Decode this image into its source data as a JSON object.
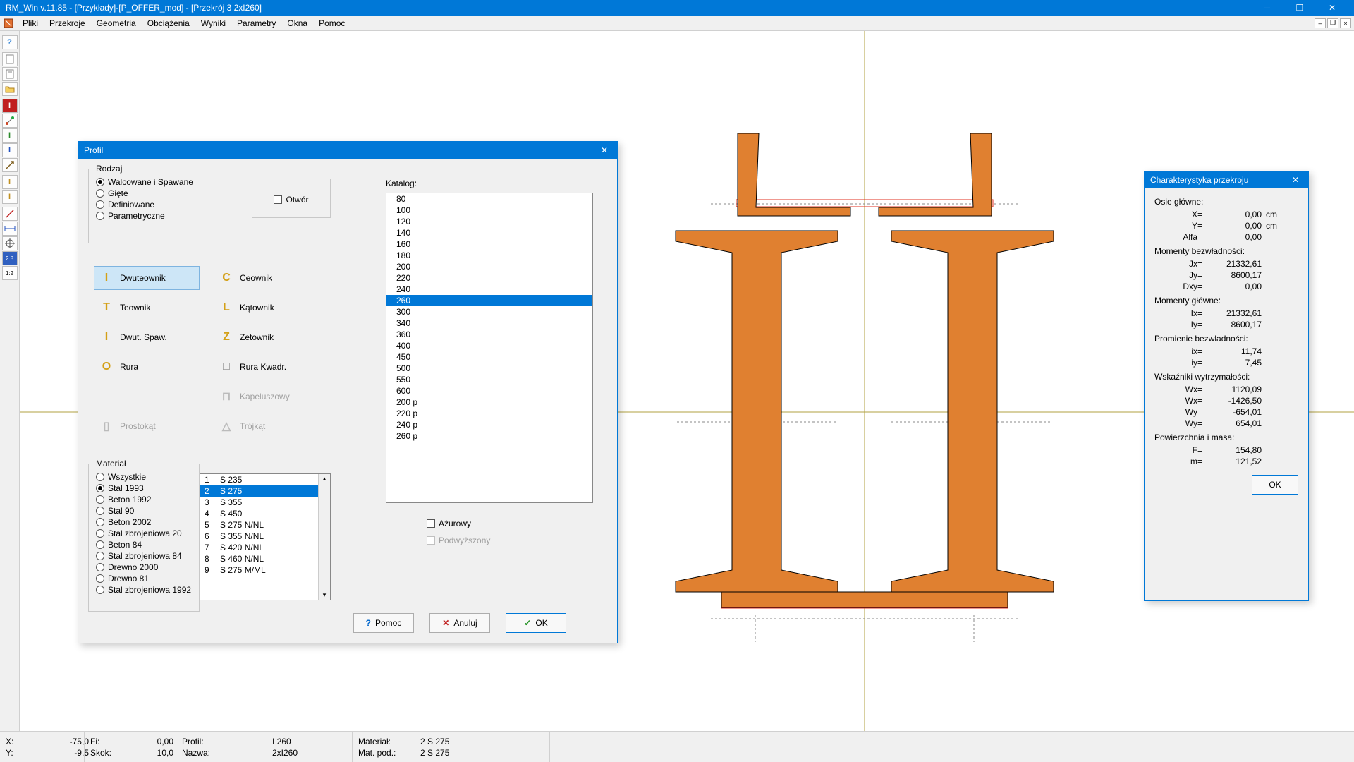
{
  "title": "RM_Win v.11.85 - [Przykłady]-[P_OFFER_mod] - [Przekrój  3  2xI260]",
  "menu": [
    "Pliki",
    "Przekroje",
    "Geometria",
    "Obciążenia",
    "Wyniki",
    "Parametry",
    "Okna",
    "Pomoc"
  ],
  "sidetools": [
    "?",
    "📄",
    "📄",
    "📂",
    "I",
    "⊕",
    "I",
    "I",
    "↗",
    "",
    "I",
    "I",
    "",
    "↗",
    "I",
    "↔",
    "⊕",
    "2.8",
    "1:2"
  ],
  "profile_dialog": {
    "title": "Profil",
    "rodzaj_label": "Rodzaj",
    "rodzaj_options": [
      "Walcowane i Spawane",
      "Gięte",
      "Definiowane",
      "Parametryczne"
    ],
    "otwor_label": "Otwór",
    "shapes": [
      {
        "label": "Dwuteownik",
        "sel": true,
        "icon": "I",
        "color": "#d4a017"
      },
      {
        "label": "Ceownik",
        "icon": "C",
        "color": "#d4a017"
      },
      {
        "label": "Teownik",
        "icon": "T",
        "color": "#d4a017"
      },
      {
        "label": "Kątownik",
        "icon": "L",
        "color": "#d4a017"
      },
      {
        "label": "Dwut. Spaw.",
        "icon": "I",
        "color": "#d4a017"
      },
      {
        "label": "Zetownik",
        "icon": "Z",
        "color": "#d4a017"
      },
      {
        "label": "Rura",
        "icon": "O",
        "color": "#d4a017"
      },
      {
        "label": "Rura Kwadr.",
        "icon": "□",
        "color": "#888"
      },
      {
        "label": "Kapeluszowy",
        "dis": true,
        "icon": "⊓",
        "color": "#bbb"
      },
      {
        "label": "Prostokąt",
        "dis": true,
        "icon": "▯",
        "color": "#bbb"
      },
      {
        "label": "Trójkąt",
        "dis": true,
        "icon": "△",
        "color": "#bbb"
      }
    ],
    "katalog_label": "Katalog:",
    "katalog_items": [
      "80",
      "100",
      "120",
      "140",
      "160",
      "180",
      "200",
      "220",
      "240",
      "260",
      "300",
      "340",
      "360",
      "400",
      "450",
      "500",
      "550",
      "600",
      "200 p",
      "220 p",
      "240 p",
      "260 p"
    ],
    "katalog_selected": "260",
    "azurowy_label": "Ażurowy",
    "podwyzszony_label": "Podwyższony",
    "material_label": "Materiał",
    "material_options": [
      "Wszystkie",
      "Stal 1993",
      "Beton 1992",
      "Stal 90",
      "Beton 2002",
      "Stal zbrojeniowa 20",
      "Beton 84",
      "Stal zbrojeniowa 84",
      "Drewno 2000",
      "Drewno 81",
      "Stal zbrojeniowa 1992"
    ],
    "material_checked": "Stal 1993",
    "material_list": [
      {
        "n": "1",
        "t": "S 235"
      },
      {
        "n": "2",
        "t": "S 275",
        "sel": true
      },
      {
        "n": "3",
        "t": "S 355"
      },
      {
        "n": "4",
        "t": "S 450"
      },
      {
        "n": "5",
        "t": "S 275 N/NL"
      },
      {
        "n": "6",
        "t": "S 355 N/NL"
      },
      {
        "n": "7",
        "t": "S 420 N/NL"
      },
      {
        "n": "8",
        "t": "S 460 N/NL"
      },
      {
        "n": "9",
        "t": "S 275 M/ML"
      }
    ],
    "btn_pomoc": "Pomoc",
    "btn_anuluj": "Anuluj",
    "btn_ok": "OK"
  },
  "char_dialog": {
    "title": "Charakterystyka przekroju",
    "sections": [
      {
        "title": "Osie główne:",
        "rows": [
          {
            "k": "X=",
            "v": "0,00",
            "u": "cm"
          },
          {
            "k": "Y=",
            "v": "0,00",
            "u": "cm"
          },
          {
            "k": "Alfa=",
            "v": "0,00",
            "u": ""
          }
        ]
      },
      {
        "title": "Momenty bezwładności:",
        "rows": [
          {
            "k": "Jx=",
            "v": "21332,61",
            "u": ""
          },
          {
            "k": "Jy=",
            "v": "8600,17",
            "u": ""
          },
          {
            "k": "Dxy=",
            "v": "0,00",
            "u": ""
          }
        ]
      },
      {
        "title": "Momenty główne:",
        "rows": [
          {
            "k": "Ix=",
            "v": "21332,61",
            "u": ""
          },
          {
            "k": "Iy=",
            "v": "8600,17",
            "u": ""
          }
        ]
      },
      {
        "title": "Promienie bezwładności:",
        "rows": [
          {
            "k": "ix=",
            "v": "11,74",
            "u": ""
          },
          {
            "k": "iy=",
            "v": "7,45",
            "u": ""
          }
        ]
      },
      {
        "title": "Wskaźniki wytrzymałości:",
        "rows": [
          {
            "k": "Wx=",
            "v": "1120,09",
            "u": ""
          },
          {
            "k": "Wx=",
            "v": "-1426,50",
            "u": ""
          },
          {
            "k": "Wy=",
            "v": "-654,01",
            "u": ""
          },
          {
            "k": "Wy=",
            "v": "654,01",
            "u": ""
          }
        ]
      },
      {
        "title": "Powierzchnia i masa:",
        "rows": [
          {
            "k": "F=",
            "v": "154,80",
            "u": ""
          },
          {
            "k": "m=",
            "v": "121,52",
            "u": ""
          }
        ]
      }
    ],
    "ok": "OK"
  },
  "status": {
    "x_lbl": "X:",
    "x": "-75,0",
    "fi_lbl": "Fi:",
    "fi": "0,00",
    "y_lbl": "Y:",
    "y": "-9,5",
    "skok_lbl": "Skok:",
    "skok": "10,0",
    "profil_lbl": "Profil:",
    "profil": "I 260",
    "nazwa_lbl": "Nazwa:",
    "nazwa": "2xI260",
    "material_lbl": "Materiał:",
    "material": "2 S 275",
    "matpod_lbl": "Mat. pod.:",
    "matpod": "2 S 275"
  }
}
